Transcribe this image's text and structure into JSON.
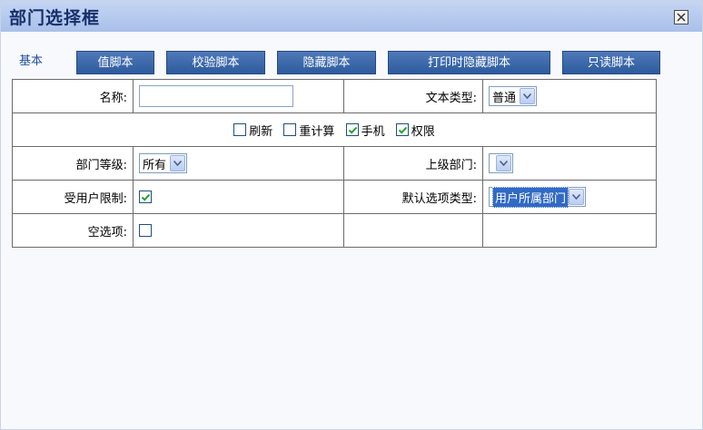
{
  "window": {
    "title": "部门选择框"
  },
  "tabs": [
    {
      "label": "基本",
      "active": true
    },
    {
      "label": "值脚本",
      "active": false
    },
    {
      "label": "校验脚本",
      "active": false
    },
    {
      "label": "隐藏脚本",
      "active": false
    },
    {
      "label": "打印时隐藏脚本",
      "active": false
    },
    {
      "label": "只读脚本",
      "active": false
    }
  ],
  "form": {
    "name_label": "名称:",
    "name_value": "",
    "text_type_label": "文本类型:",
    "text_type_value": "普通",
    "checkboxes": [
      {
        "label": "刷新",
        "checked": false
      },
      {
        "label": "重计算",
        "checked": false
      },
      {
        "label": "手机",
        "checked": true
      },
      {
        "label": "权限",
        "checked": true
      }
    ],
    "dept_level_label": "部门等级:",
    "dept_level_value": "所有",
    "parent_dept_label": "上级部门:",
    "parent_dept_value": "",
    "user_limit_label": "受用户限制:",
    "user_limit_checked": true,
    "default_option_label": "默认选项类型:",
    "default_option_value": "用户所属部门",
    "empty_option_label": "空选项:",
    "empty_option_checked": false
  },
  "colors": {
    "titlebar": "#b4c9ef",
    "tab": "#3a66a8",
    "selection": "#316ac5"
  }
}
